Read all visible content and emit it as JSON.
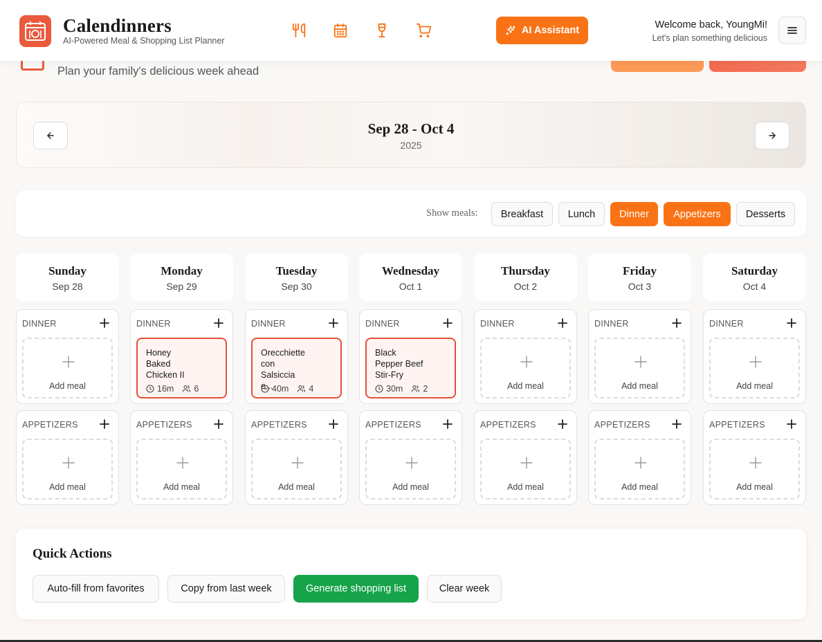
{
  "app": {
    "name": "Calendinners",
    "tagline": "AI-Powered Meal & Shopping List Planner"
  },
  "nav": {
    "icons": [
      "utensils-icon",
      "calendar-icon",
      "wine-glass-icon",
      "shopping-cart-icon"
    ],
    "ai_button_label": "AI Assistant",
    "welcome_line1": "Welcome back, YoungMi!",
    "welcome_line2": "Let's plan something delicious"
  },
  "page": {
    "subtitle": "Plan your family's delicious week ahead"
  },
  "week": {
    "range": "Sep 28 - Oct 4",
    "year": "2025"
  },
  "filters": {
    "label": "Show meals:",
    "chips": [
      {
        "label": "Breakfast",
        "active": false
      },
      {
        "label": "Lunch",
        "active": false
      },
      {
        "label": "Dinner",
        "active": true
      },
      {
        "label": "Appetizers",
        "active": true
      },
      {
        "label": "Desserts",
        "active": false
      }
    ]
  },
  "days": [
    {
      "name": "Sunday",
      "date": "Sep 28"
    },
    {
      "name": "Monday",
      "date": "Sep 29"
    },
    {
      "name": "Tuesday",
      "date": "Sep 30"
    },
    {
      "name": "Wednesday",
      "date": "Oct 1"
    },
    {
      "name": "Thursday",
      "date": "Oct 2"
    },
    {
      "name": "Friday",
      "date": "Oct 3"
    },
    {
      "name": "Saturday",
      "date": "Oct 4"
    }
  ],
  "slots": {
    "dinner_label": "DINNER",
    "appetizers_label": "APPETIZERS",
    "add_meal_label": "Add meal"
  },
  "meals": {
    "monday_dinner": {
      "name": "Honey Baked Chicken II",
      "time": "16m",
      "servings": "6"
    },
    "tuesday_dinner": {
      "name": "Orecchiette con Salsiccia e...",
      "time": "40m",
      "servings": "4"
    },
    "wednesday_dinner": {
      "name": "Black Pepper Beef Stir-Fry",
      "time": "30m",
      "servings": "2"
    }
  },
  "quick_actions": {
    "title": "Quick Actions",
    "autofill": "Auto-fill from favorites",
    "copy": "Copy from last week",
    "generate": "Generate shopping list",
    "clear": "Clear week"
  },
  "colors": {
    "accent": "#f97316",
    "brand": "#ea5a3c",
    "meal_border": "#e2513a",
    "success": "#16a34a"
  }
}
